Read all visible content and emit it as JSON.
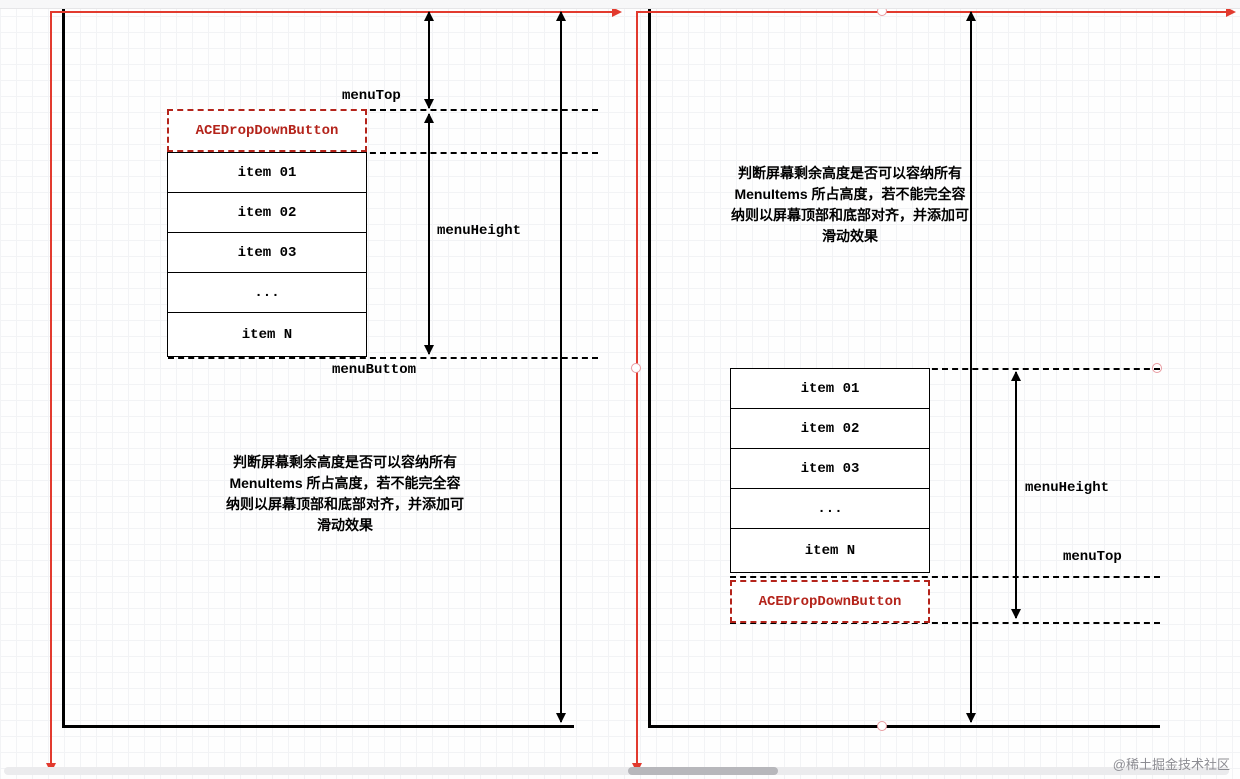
{
  "button_label": "ACEDropDownButton",
  "items": [
    "item 01",
    "item 02",
    "item 03",
    "...",
    "item N"
  ],
  "labels": {
    "menuTop": "menuTop",
    "menuHeight": "menuHeight",
    "menuBottom": "menuButtom"
  },
  "description": {
    "l1": "判断屏幕剩余高度是否可以容纳所有",
    "l2": "MenuItems 所占高度，若不能完全容",
    "l3": "纳则以屏幕顶部和底部对齐，并添加可",
    "l4": "滑动效果"
  },
  "watermark": "@稀土掘金技术社区"
}
